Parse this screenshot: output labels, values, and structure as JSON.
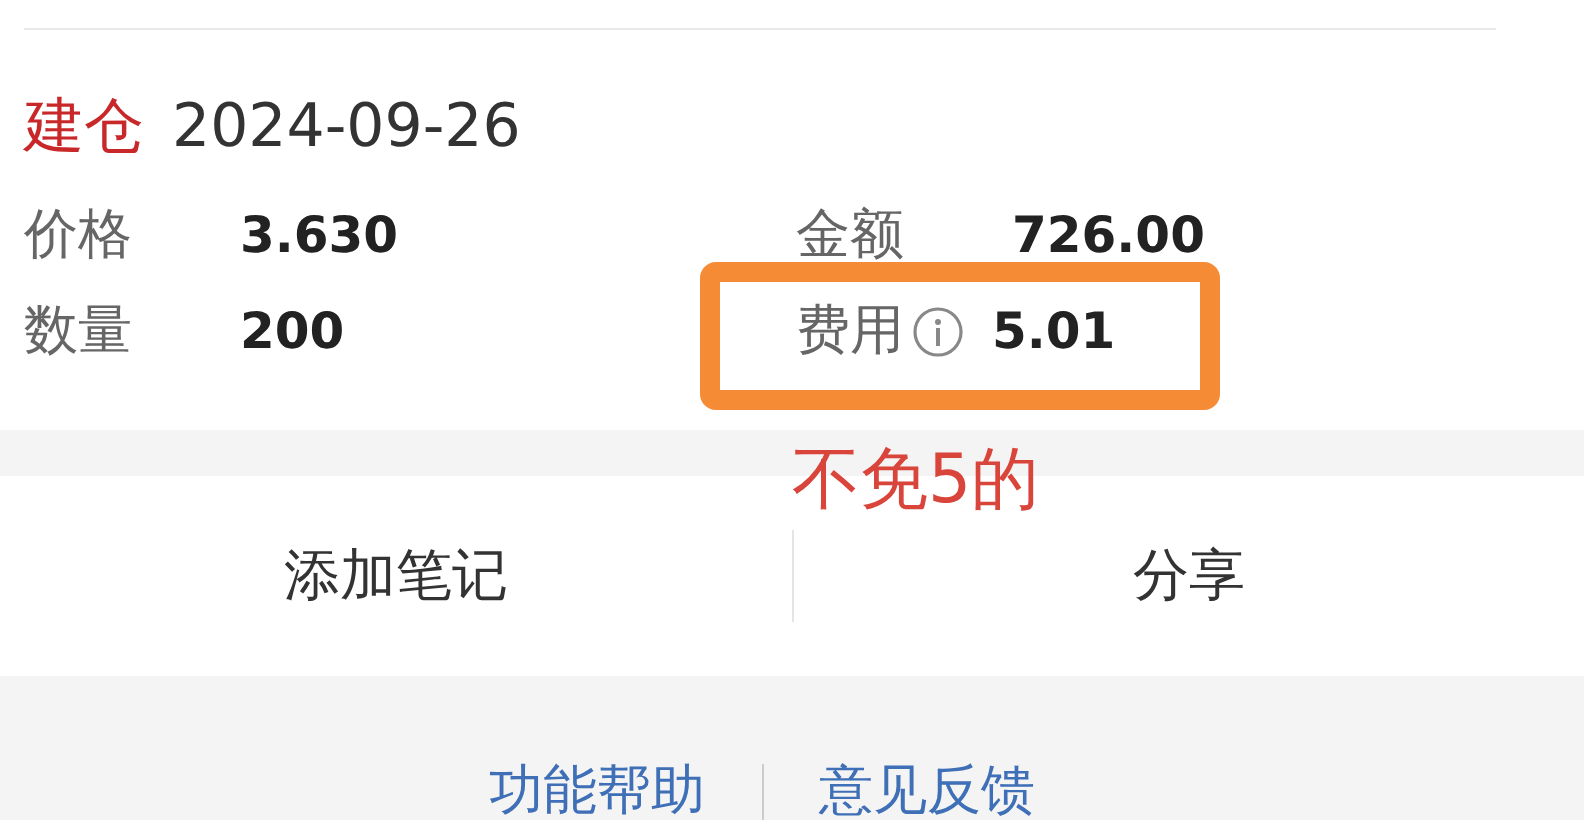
{
  "trade": {
    "action": "建仓",
    "date": "2024-09-26",
    "fields": [
      {
        "label": "价格",
        "value": "3.630",
        "info": false
      },
      {
        "label": "金额",
        "value": "726.00",
        "info": false
      },
      {
        "label": "数量",
        "value": "200",
        "info": false
      },
      {
        "label": "费用",
        "value": "5.01",
        "info": true,
        "highlighted": true
      }
    ]
  },
  "annotation": {
    "text": "不免5的"
  },
  "actions": [
    {
      "label": "添加笔记"
    },
    {
      "label": "分享"
    }
  ],
  "footer_links": [
    {
      "label": "功能帮助"
    },
    {
      "label": "意见反馈"
    }
  ]
}
